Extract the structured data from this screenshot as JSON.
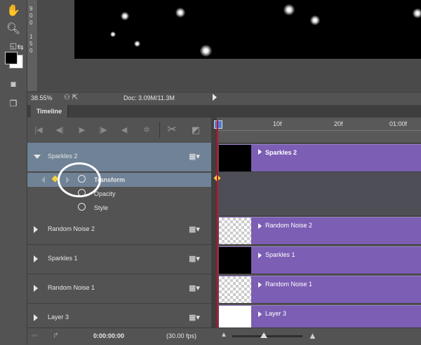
{
  "toolbar": {
    "tools": [
      "hand-icon",
      "zoom-icon",
      "default-colors-icon",
      "swap-colors-icon",
      "foreground-color-swatch",
      "quick-mask-icon",
      "screen-mode-icon"
    ]
  },
  "ruler": {
    "ticks": [
      "9",
      "0",
      "0",
      "1",
      "5",
      "0"
    ]
  },
  "status": {
    "zoom": "38.55%",
    "doc": "Doc: 3.09M/11.3M"
  },
  "timeline": {
    "tab": "Timeline",
    "ruler_labels": [
      "10f",
      "20f",
      "01:00f"
    ],
    "layers": [
      {
        "name": "Sparkles 2",
        "expanded": true,
        "selected": true
      },
      {
        "name": "Random Noise 2"
      },
      {
        "name": "Sparkles 1"
      },
      {
        "name": "Random Noise 1"
      },
      {
        "name": "Layer 3"
      }
    ],
    "properties": [
      {
        "name": "Transform",
        "bold": true
      },
      {
        "name": "Opacity"
      },
      {
        "name": "Style"
      }
    ],
    "clips": [
      {
        "label": "Sparkles 2",
        "thumb": "black"
      },
      {
        "label": "Random Noise 2",
        "thumb": "checker"
      },
      {
        "label": "Sparkles 1",
        "thumb": "black"
      },
      {
        "label": "Random Noise 1",
        "thumb": "checker"
      },
      {
        "label": "Layer 3",
        "thumb": "white"
      }
    ],
    "timecode": "0:00:00:00",
    "fps": "(30.00 fps)"
  },
  "colors": {
    "clip": "#7c5eb4",
    "selected_row": "#6f8296",
    "playhead": "#c8102e"
  }
}
